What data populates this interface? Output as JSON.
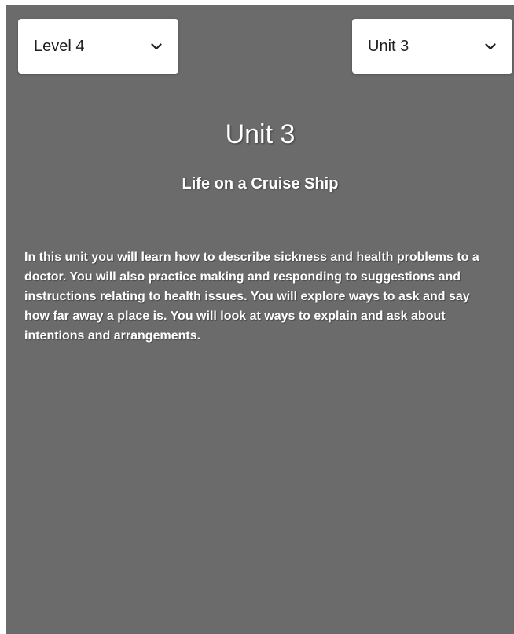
{
  "level_select": {
    "value": "Level 4",
    "icon": "chevron-down-icon"
  },
  "unit_select": {
    "value": "Unit 3",
    "icon": "chevron-down-icon"
  },
  "unit": {
    "title": "Unit 3",
    "subtitle": "Life on a Cruise Ship",
    "description": "In this unit you will learn how to describe sickness and health problems to a doctor. You will also practice making and responding to suggestions and instructions relating to health issues. You will explore ways to ask and say how far away a place is. You will look at ways to explain and ask about intentions and arrangements."
  },
  "colors": {
    "panel_background": "#6b6b6b",
    "text": "#ffffff",
    "select_background": "#ffffff"
  }
}
